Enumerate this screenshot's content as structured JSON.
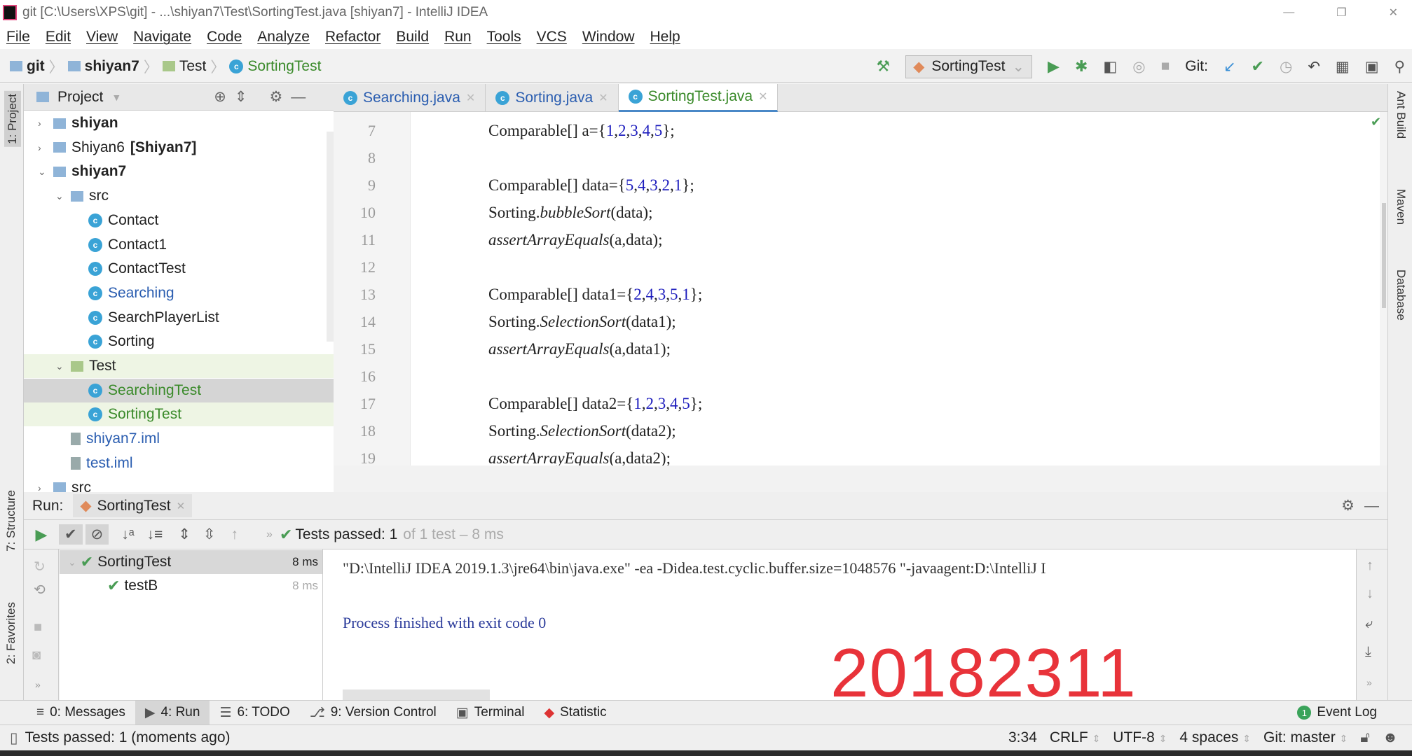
{
  "window": {
    "title": "git [C:\\Users\\XPS\\git] - ...\\shiyan7\\Test\\SortingTest.java [shiyan7] - IntelliJ IDEA",
    "controls": [
      "—",
      "❐",
      "✕"
    ]
  },
  "menu": [
    "File",
    "Edit",
    "View",
    "Navigate",
    "Code",
    "Analyze",
    "Refactor",
    "Build",
    "Run",
    "Tools",
    "VCS",
    "Window",
    "Help"
  ],
  "breadcrumb": [
    "git",
    "shiyan7",
    "Test",
    "SortingTest"
  ],
  "toolbar": {
    "run_config": "SortingTest",
    "git_label": "Git:"
  },
  "project": {
    "title": "Project",
    "tree": [
      {
        "label": "shiyan",
        "bold": true,
        "type": "module",
        "depth": 0,
        "arrow": "›"
      },
      {
        "label": "Shiyan6",
        "suffix": "[Shiyan7]",
        "type": "module",
        "depth": 0,
        "arrow": "›"
      },
      {
        "label": "shiyan7",
        "bold": true,
        "type": "module",
        "depth": 0,
        "arrow": "⌄"
      },
      {
        "label": "src",
        "type": "folder",
        "depth": 1,
        "arrow": "⌄"
      },
      {
        "label": "Contact",
        "type": "class",
        "depth": 2
      },
      {
        "label": "Contact1",
        "type": "class",
        "depth": 2
      },
      {
        "label": "ContactTest",
        "type": "class",
        "depth": 2
      },
      {
        "label": "Searching",
        "type": "class",
        "depth": 2,
        "color": "blue"
      },
      {
        "label": "SearchPlayerList",
        "type": "class",
        "depth": 2
      },
      {
        "label": "Sorting",
        "type": "class",
        "depth": 2
      },
      {
        "label": "Test",
        "type": "testfolder",
        "depth": 1,
        "arrow": "⌄",
        "hl": "g"
      },
      {
        "label": "SearchingTest",
        "type": "class",
        "depth": 2,
        "color": "green",
        "hl": "s"
      },
      {
        "label": "SortingTest",
        "type": "class",
        "depth": 2,
        "color": "green",
        "hl": "g"
      },
      {
        "label": "shiyan7.iml",
        "type": "file",
        "depth": 1,
        "color": "blue"
      },
      {
        "label": "test.iml",
        "type": "file",
        "depth": 1,
        "color": "blue"
      },
      {
        "label": "src",
        "type": "folder",
        "depth": 0,
        "arrow": "›"
      }
    ]
  },
  "tabs": [
    {
      "label": "Searching.java",
      "active": false
    },
    {
      "label": "Sorting.java",
      "active": false
    },
    {
      "label": "SortingTest.java",
      "active": true
    }
  ],
  "code": [
    {
      "n": "7",
      "html": "Comparable[] a={<span class=num>1</span>,<span class=num>2</span>,<span class=num>3</span>,<span class=num>4</span>,<span class=num>5</span>};"
    },
    {
      "n": "8",
      "html": ""
    },
    {
      "n": "9",
      "html": "Comparable[] data={<span class=num>5</span>,<span class=num>4</span>,<span class=num>3</span>,<span class=num>2</span>,<span class=num>1</span>};"
    },
    {
      "n": "10",
      "html": "Sorting.<i>bubbleSort</i>(data);"
    },
    {
      "n": "11",
      "html": "<i>assertArrayEquals</i>(a,data);"
    },
    {
      "n": "12",
      "html": ""
    },
    {
      "n": "13",
      "html": "Comparable[] data1={<span class=num>2</span>,<span class=num>4</span>,<span class=num>3</span>,<span class=num>5</span>,<span class=num>1</span>};"
    },
    {
      "n": "14",
      "html": "Sorting.<i>SelectionSort</i>(data1);"
    },
    {
      "n": "15",
      "html": "<i>assertArrayEquals</i>(a,data1);"
    },
    {
      "n": "16",
      "html": ""
    },
    {
      "n": "17",
      "html": "Comparable[] data2={<span class=num>1</span>,<span class=num>2</span>,<span class=num>3</span>,<span class=num>4</span>,<span class=num>5</span>};"
    },
    {
      "n": "18",
      "html": "Sorting.<i>SelectionSort</i>(data2);"
    },
    {
      "n": "19",
      "html": "<i>assertArrayEquals</i>(a,data2);"
    }
  ],
  "right_strip": [
    "Ant Build",
    "Maven",
    "Database"
  ],
  "left_strip": [
    "1: Project",
    "7: Structure",
    "2: Favorites"
  ],
  "run": {
    "label": "Run:",
    "tab": "SortingTest",
    "status_bold": "Tests passed: 1",
    "status_rest": "of 1 test – 8 ms",
    "tests": [
      {
        "name": "SortingTest",
        "time": "8 ms"
      },
      {
        "name": "testB",
        "time": "8 ms"
      }
    ],
    "console": [
      "\"D:\\IntelliJ IDEA 2019.1.3\\jre64\\bin\\java.exe\" -ea -Didea.test.cyclic.buffer.size=1048576 \"-javaagent:D:\\IntelliJ I",
      "Process finished with exit code 0"
    ]
  },
  "watermark": "20182311",
  "bottom_tools": [
    {
      "label": "0: Messages",
      "icon": "≡"
    },
    {
      "label": "4: Run",
      "icon": "▶",
      "active": true
    },
    {
      "label": "6: TODO",
      "icon": "☰"
    },
    {
      "label": "9: Version Control",
      "icon": "⎇"
    },
    {
      "label": "Terminal",
      "icon": "▣"
    },
    {
      "label": "Statistic",
      "icon": "◆"
    }
  ],
  "event_log": {
    "label": "Event Log",
    "count": "1"
  },
  "status": {
    "message": "Tests passed: 1 (moments ago)",
    "position": "3:34",
    "line_sep": "CRLF",
    "encoding": "UTF-8",
    "indent": "4 spaces",
    "vcs": "Git: master"
  }
}
